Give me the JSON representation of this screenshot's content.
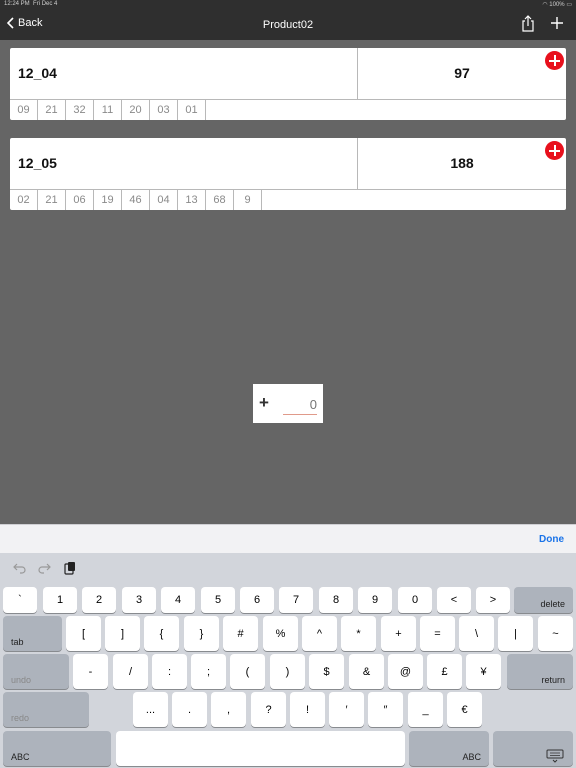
{
  "status_bar": {
    "time": "12:24 PM",
    "date": "Fri Dec 4",
    "battery": "100%"
  },
  "nav": {
    "back_label": "Back",
    "title": "Product02"
  },
  "cards": [
    {
      "name": "12_04",
      "count": "97",
      "tags": [
        "09",
        "21",
        "32",
        "11",
        "20",
        "03",
        "01"
      ]
    },
    {
      "name": "12_05",
      "count": "188",
      "tags": [
        "02",
        "21",
        "06",
        "19",
        "46",
        "04",
        "13",
        "68",
        "9"
      ]
    }
  ],
  "quantity": {
    "plus": "+",
    "value": "0"
  },
  "keyboard": {
    "done_label": "Done",
    "row1": [
      "`",
      "1",
      "2",
      "3",
      "4",
      "5",
      "6",
      "7",
      "8",
      "9",
      "0",
      "<",
      ">"
    ],
    "delete": "delete",
    "tab": "tab",
    "row2": [
      "[",
      "]",
      "{",
      "}",
      "#",
      "%",
      "^",
      "*",
      "+",
      "=",
      "\\",
      "|",
      "~"
    ],
    "undo": "undo",
    "row3": [
      "-",
      "/",
      ":",
      ";",
      "(",
      ")",
      "$",
      "&",
      "@",
      "£",
      "¥"
    ],
    "return": "return",
    "redo": "redo",
    "row4": [
      "...",
      ".",
      ",",
      "?",
      "!",
      "′",
      "″",
      "_",
      "€"
    ],
    "abc_left": "ABC",
    "abc_right": "ABC"
  }
}
